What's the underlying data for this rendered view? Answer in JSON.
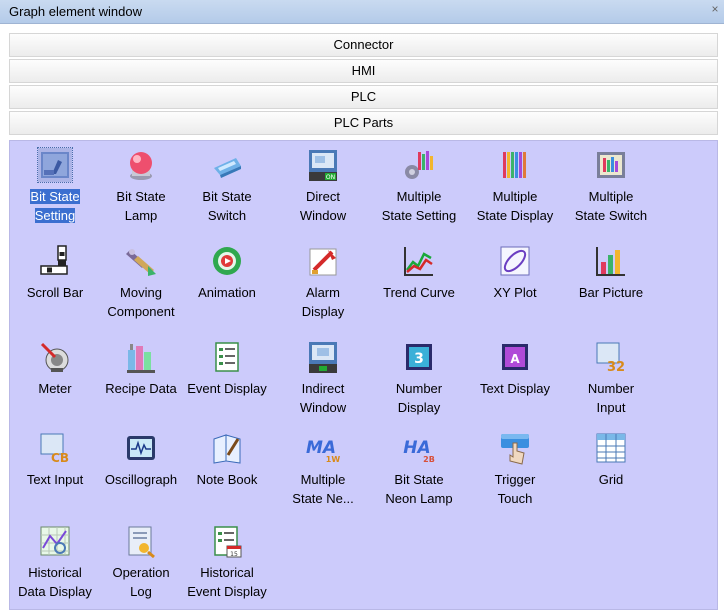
{
  "window": {
    "title": "Graph element window",
    "close_glyph": "×"
  },
  "sections": [
    "Connector",
    "HMI",
    "PLC",
    "PLC Parts"
  ],
  "items": [
    {
      "label": [
        "Bit State",
        "Setting"
      ],
      "icon": "bit-state-setting-icon",
      "selected": true
    },
    {
      "label": [
        "Bit State",
        "Lamp"
      ],
      "icon": "bit-state-lamp-icon"
    },
    {
      "label": [
        "Bit State",
        "Switch"
      ],
      "icon": "bit-state-switch-icon"
    },
    {
      "label": [
        "Direct",
        "Window"
      ],
      "icon": "direct-window-icon"
    },
    {
      "label": [
        "Multiple",
        "State Setting"
      ],
      "icon": "multiple-state-setting-icon"
    },
    {
      "label": [
        "Multiple",
        "State Display"
      ],
      "icon": "multiple-state-display-icon"
    },
    {
      "label": [
        "Multiple",
        "State Switch"
      ],
      "icon": "multiple-state-switch-icon"
    },
    {
      "label": [
        "Scroll Bar"
      ],
      "icon": "scroll-bar-icon"
    },
    {
      "label": [
        "Moving",
        "Component"
      ],
      "icon": "moving-component-icon"
    },
    {
      "label": [
        "Animation"
      ],
      "icon": "animation-icon"
    },
    {
      "label": [
        "Alarm",
        "Display"
      ],
      "icon": "alarm-display-icon"
    },
    {
      "label": [
        "Trend Curve"
      ],
      "icon": "trend-curve-icon"
    },
    {
      "label": [
        "XY Plot"
      ],
      "icon": "xy-plot-icon"
    },
    {
      "label": [
        "Bar Picture"
      ],
      "icon": "bar-picture-icon"
    },
    {
      "label": [
        "Meter"
      ],
      "icon": "meter-icon"
    },
    {
      "label": [
        "Recipe Data"
      ],
      "icon": "recipe-data-icon"
    },
    {
      "label": [
        "Event Display"
      ],
      "icon": "event-display-icon"
    },
    {
      "label": [
        "Indirect",
        "Window"
      ],
      "icon": "indirect-window-icon"
    },
    {
      "label": [
        "Number",
        "Display"
      ],
      "icon": "number-display-icon"
    },
    {
      "label": [
        "Text Display"
      ],
      "icon": "text-display-icon"
    },
    {
      "label": [
        "Number",
        "Input"
      ],
      "icon": "number-input-icon"
    },
    {
      "label": [
        "Text Input"
      ],
      "icon": "text-input-icon"
    },
    {
      "label": [
        "Oscillograph"
      ],
      "icon": "oscillograph-icon"
    },
    {
      "label": [
        "Note Book"
      ],
      "icon": "note-book-icon"
    },
    {
      "label": [
        "Multiple",
        "State Ne..."
      ],
      "icon": "multiple-state-neon-lamp-icon"
    },
    {
      "label": [
        "Bit State",
        "Neon Lamp"
      ],
      "icon": "bit-state-neon-lamp-icon"
    },
    {
      "label": [
        "Trigger",
        "Touch"
      ],
      "icon": "trigger-touch-icon"
    },
    {
      "label": [
        "Grid"
      ],
      "icon": "grid-icon"
    },
    {
      "label": [
        "Historical",
        "Data Display"
      ],
      "icon": "historical-data-display-icon"
    },
    {
      "label": [
        "Operation",
        "Log"
      ],
      "icon": "operation-log-icon"
    },
    {
      "label": [
        "Historical",
        "Event Display"
      ],
      "icon": "historical-event-display-icon"
    }
  ],
  "icon_text": {
    "direct-window-icon": "ON"
  }
}
